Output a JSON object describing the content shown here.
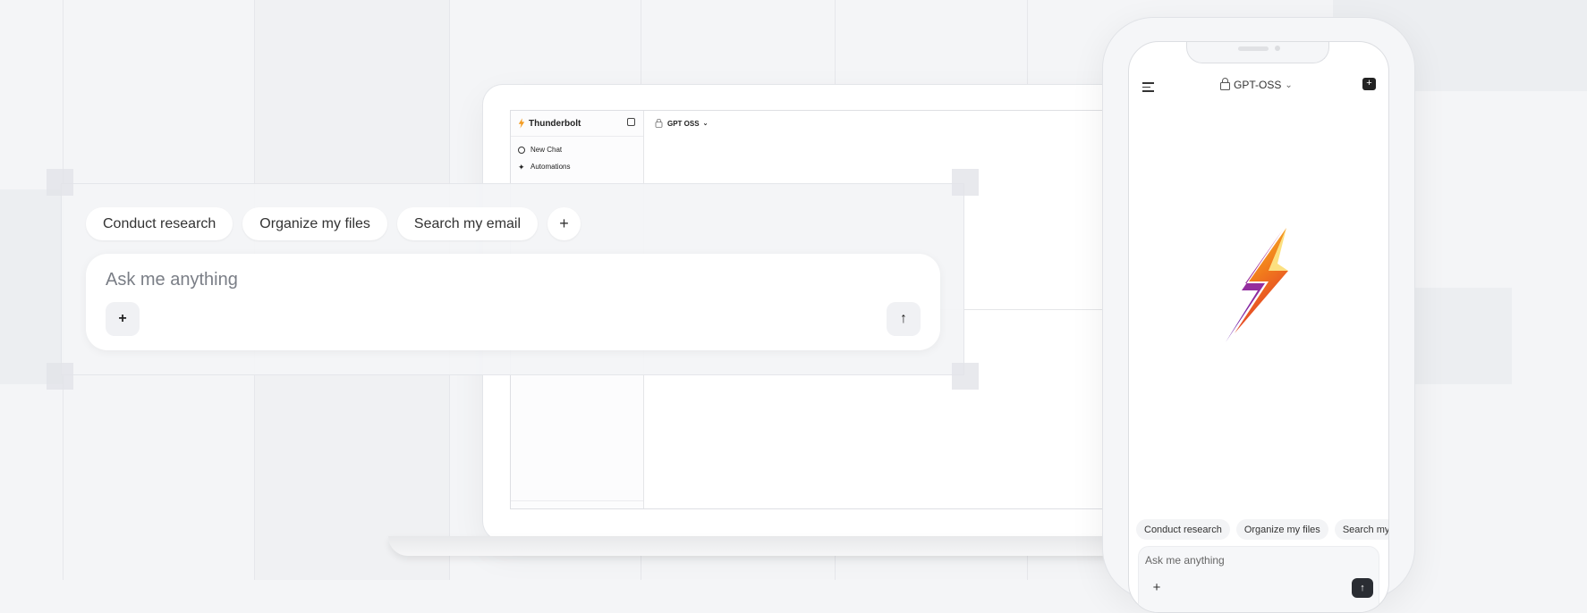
{
  "laptop": {
    "brand": "Thunderbolt",
    "model": "GPT OSS",
    "nav": [
      {
        "label": "New Chat",
        "icon": "chat-bubble-icon"
      },
      {
        "label": "Automations",
        "icon": "sparkle-icon"
      }
    ]
  },
  "composer": {
    "suggestions": [
      "Conduct research",
      "Organize my files",
      "Search my email"
    ],
    "add_label": "+",
    "placeholder": "Ask me anything",
    "attach_label": "+",
    "send_label": "↑"
  },
  "phone": {
    "model": "GPT-OSS",
    "suggestions": [
      "Conduct research",
      "Organize my files",
      "Search my email"
    ],
    "placeholder": "Ask me anything",
    "attach_label": "+",
    "send_label": "↑"
  },
  "colors": {
    "accent_bolt_top": "#f5b323",
    "accent_bolt_mid": "#f07a1c",
    "accent_bolt_bottom": "#8a2bb8",
    "background": "#f4f5f7"
  }
}
